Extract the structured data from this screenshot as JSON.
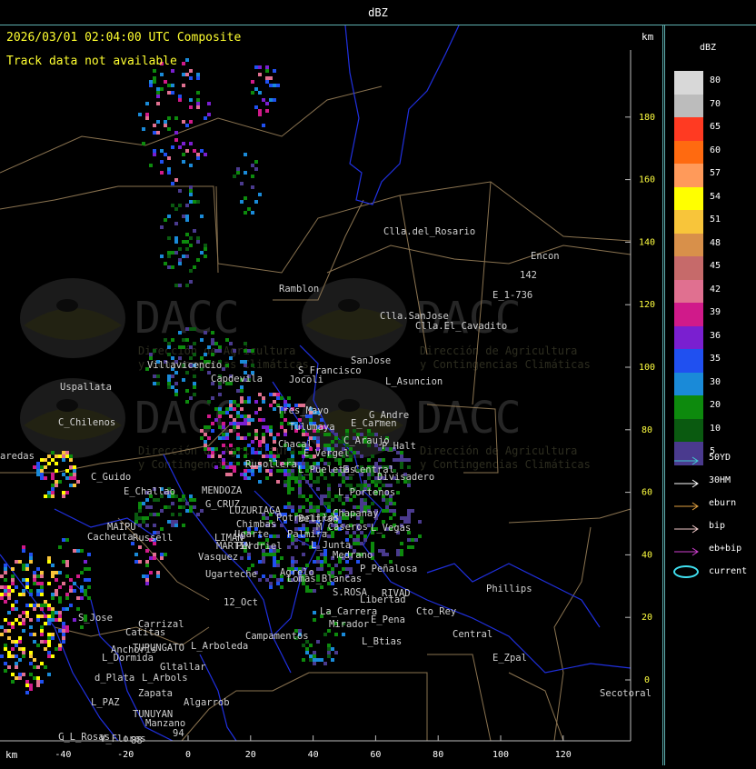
{
  "window_title": "dBZ",
  "header": {
    "timestamp": "2026/03/01 02:04:00 UTC Composite",
    "track_note": "Track data not available",
    "km_top": "km",
    "km_bottom": "km"
  },
  "axes": {
    "x_ticks": [
      "-40",
      "-20",
      "0",
      "20",
      "40",
      "60",
      "80",
      "100",
      "120"
    ],
    "y_ticks": [
      "180",
      "160",
      "140",
      "120",
      "100",
      "80",
      "60",
      "40",
      "20",
      "0"
    ]
  },
  "colorbar": {
    "title": "dBZ",
    "levels": [
      {
        "label": "80",
        "color": "#d8d8d8"
      },
      {
        "label": "70",
        "color": "#bcbcbc"
      },
      {
        "label": "65",
        "color": "#ff3a22"
      },
      {
        "label": "60",
        "color": "#ff6a10"
      },
      {
        "label": "57",
        "color": "#ff9a5a"
      },
      {
        "label": "54",
        "color": "#ffff00"
      },
      {
        "label": "51",
        "color": "#f8c53a"
      },
      {
        "label": "48",
        "color": "#d8904a"
      },
      {
        "label": "45",
        "color": "#c66a6a"
      },
      {
        "label": "42",
        "color": "#e07090"
      },
      {
        "label": "39",
        "color": "#d01a8a"
      },
      {
        "label": "36",
        "color": "#7a1fd0"
      },
      {
        "label": "35",
        "color": "#2050f0"
      },
      {
        "label": "30",
        "color": "#1a8ad8"
      },
      {
        "label": "20",
        "color": "#0d8a0d"
      },
      {
        "label": "10",
        "color": "#0a5a10"
      },
      {
        "label": "5",
        "color": "#4a3a8e"
      }
    ]
  },
  "track_legend": [
    {
      "label": "50YD",
      "color": "#40c8d0"
    },
    {
      "label": "30HM",
      "color": "#ffffff"
    },
    {
      "label": "eburn",
      "color": "#e0a040"
    },
    {
      "label": "bip",
      "color": "#f0c8c8"
    },
    {
      "label": "eb+bip",
      "color": "#d040d0"
    },
    {
      "label": "current",
      "color": "#40e0f0"
    }
  ],
  "watermark": {
    "name": "DACC",
    "line1": "Dirección de Agricultura",
    "line2": "y Contingencias Climáticas"
  },
  "places": [
    {
      "name": "Clla.del_Rosario"
    },
    {
      "name": "Encon"
    },
    {
      "name": "142"
    },
    {
      "name": "E_1-736"
    },
    {
      "name": "Ramblon"
    },
    {
      "name": "Clla.SanJose"
    },
    {
      "name": "Clla.El_Cavadito"
    },
    {
      "name": "Villavicencio"
    },
    {
      "name": "Capdevila"
    },
    {
      "name": "S_Francisco"
    },
    {
      "name": "Jocoli"
    },
    {
      "name": "SanJose"
    },
    {
      "name": "L_Asuncion"
    },
    {
      "name": "Uspallata"
    },
    {
      "name": "Tres_Mayo"
    },
    {
      "name": "G_Andre"
    },
    {
      "name": "E_Carmen"
    },
    {
      "name": "C_Chilenos"
    },
    {
      "name": "Tulumaya"
    },
    {
      "name": "C_Araujo"
    },
    {
      "name": "P_Halt"
    },
    {
      "name": "aredas"
    },
    {
      "name": "Chacal"
    },
    {
      "name": "E_Vergel"
    },
    {
      "name": "Rusollera"
    },
    {
      "name": "L_Pueletas"
    },
    {
      "name": "E_Central"
    },
    {
      "name": "Divisadero"
    },
    {
      "name": "C_Guido"
    },
    {
      "name": "E_Challao"
    },
    {
      "name": "MENDOZA"
    },
    {
      "name": "L_Portenos"
    },
    {
      "name": "G_CRUZ"
    },
    {
      "name": "LUZURIAGA"
    },
    {
      "name": "Chapanay"
    },
    {
      "name": "Beltran"
    },
    {
      "name": "Potrerillos"
    },
    {
      "name": "MAIPU"
    },
    {
      "name": "Chimbas"
    },
    {
      "name": "M_Caseros"
    },
    {
      "name": "L_Vegas"
    },
    {
      "name": "Cacheuta"
    },
    {
      "name": "Russell"
    },
    {
      "name": "Ugarte"
    },
    {
      "name": "Palmira"
    },
    {
      "name": "LIMAN"
    },
    {
      "name": "L_Junta"
    },
    {
      "name": "MARTIN"
    },
    {
      "name": "Perdriel"
    },
    {
      "name": "Medrano"
    },
    {
      "name": "Vasquez"
    },
    {
      "name": "Agrelo"
    },
    {
      "name": "P_Peñalosa"
    },
    {
      "name": "Ugarteche"
    },
    {
      "name": "Lomas_Blancas"
    },
    {
      "name": "12_Oct"
    },
    {
      "name": "Phillips"
    },
    {
      "name": "RIVAD"
    },
    {
      "name": "Libertad"
    },
    {
      "name": "S.ROSA"
    },
    {
      "name": "La_Carrera"
    },
    {
      "name": "Cto_Rey"
    },
    {
      "name": "S_Jose"
    },
    {
      "name": "Carrizal"
    },
    {
      "name": "Catitas"
    },
    {
      "name": "Campamentos"
    },
    {
      "name": "Central"
    },
    {
      "name": "Mirador"
    },
    {
      "name": "E_Pena"
    },
    {
      "name": "L_Btias"
    },
    {
      "name": "Anchoris"
    },
    {
      "name": "TUPUNGATO"
    },
    {
      "name": "L_Arboleda"
    },
    {
      "name": "L_Dormida"
    },
    {
      "name": "Gltallar"
    },
    {
      "name": "E_Zpal"
    },
    {
      "name": "d_Plata"
    },
    {
      "name": "L_Arbols"
    },
    {
      "name": "Zapata"
    },
    {
      "name": "L_PAZ"
    },
    {
      "name": "Algarrob"
    },
    {
      "name": "Secotoral"
    },
    {
      "name": "TUNUYAN"
    },
    {
      "name": "Manzano"
    },
    {
      "name": "94"
    },
    {
      "name": "C_L_Rosas"
    },
    {
      "name": "V_Flores"
    },
    {
      "name": "88"
    }
  ]
}
